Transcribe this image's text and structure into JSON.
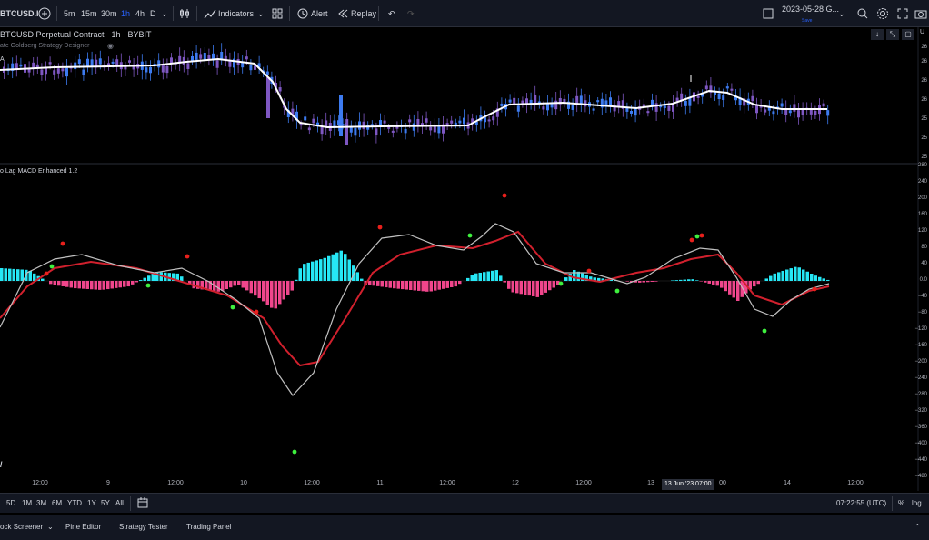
{
  "toolbar": {
    "symbol": "BTCUSD.I",
    "intervals": [
      "5m",
      "15m",
      "30m",
      "1h",
      "4h",
      "D"
    ],
    "active_interval": "1h",
    "indicators_label": "Indicators",
    "alert_label": "Alert",
    "replay_label": "Replay",
    "date_label": "2023-05-28 G...",
    "save_sublabel": "Save"
  },
  "main_pane": {
    "title": "BTCUSD Perpetual Contract · 1h · BYBIT",
    "subtitle": "ate Goldberg Strategy Designer",
    "indicator_tag": "A",
    "y_labels": [
      "26",
      "26",
      "26",
      "26",
      "25",
      "25",
      "25"
    ]
  },
  "macd_pane": {
    "title": "o Lag MACD Enhanced 1.2",
    "y_labels": [
      "280",
      "240",
      "200",
      "160",
      "120",
      "80",
      "40",
      "0.0",
      "−40",
      "−80",
      "−120",
      "−160",
      "−200",
      "−240",
      "−280",
      "−320",
      "−360",
      "−400",
      "−440",
      "−480"
    ]
  },
  "x_axis": {
    "labels": [
      "12:00",
      "9",
      "12:00",
      "10",
      "12:00",
      "11",
      "12:00",
      "12",
      "12:00",
      "13",
      "00",
      "12:00",
      "14",
      "12:00"
    ],
    "cursor_label": "13 Jun '23",
    "cursor_time": "07:00"
  },
  "bottom_bar": {
    "ranges": [
      "5D",
      "1M",
      "3M",
      "6M",
      "YTD",
      "1Y",
      "5Y",
      "All"
    ],
    "time": "07:22:55 (UTC)",
    "percent": "%",
    "log": "log"
  },
  "tabs": [
    "ock Screener",
    "Pine Editor",
    "Strategy Tester",
    "Trading Panel"
  ],
  "colors": {
    "up_candle": "#3d7bf0",
    "down_candle": "#7e57c2",
    "ma_line": "#ffffff",
    "hist_pos": "#26e7f5",
    "hist_neg": "#f0468c",
    "signal_line": "#d1202d",
    "macd_line": "#c0c0c0",
    "dot_green": "#3ef03e",
    "dot_red": "#e8201c"
  }
}
